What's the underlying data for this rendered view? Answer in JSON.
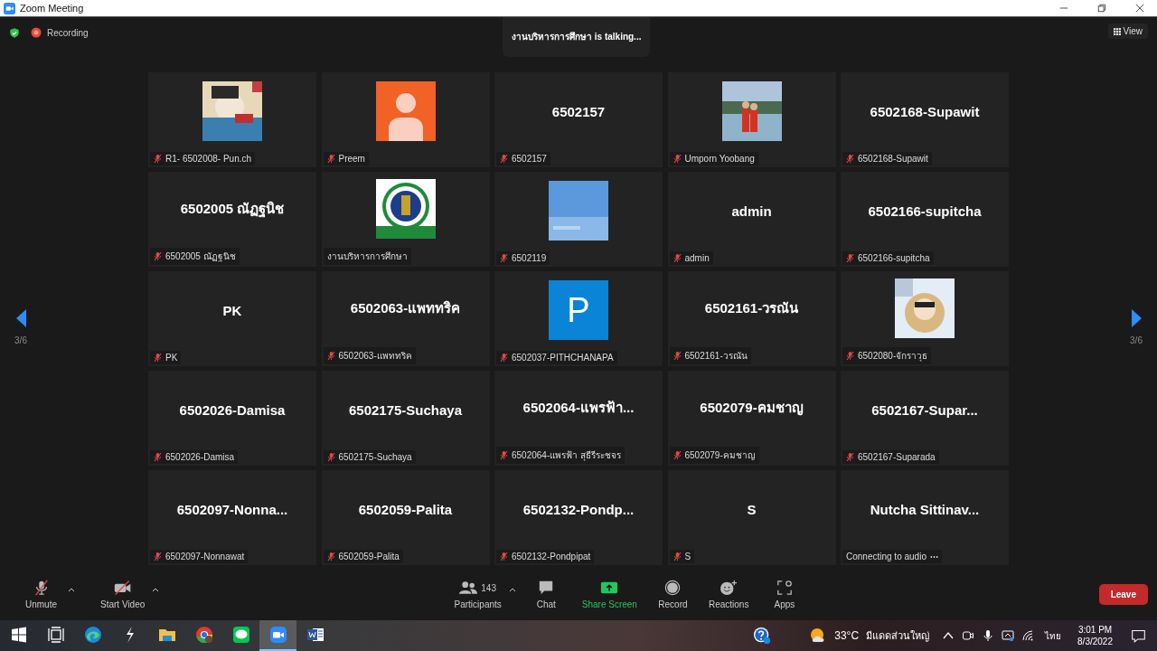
{
  "window": {
    "title": "Zoom Meeting"
  },
  "top_bar": {
    "recording": "Recording",
    "talking": "งานบริหารการศึกษา is  talking...",
    "view": "View"
  },
  "pager": {
    "left": "3/6",
    "right": "3/6"
  },
  "tiles": [
    {
      "kind": "picture",
      "label": "R1- 6502008- Pun.ch",
      "muted": true
    },
    {
      "kind": "silhouette",
      "label": "Preem",
      "muted": true
    },
    {
      "kind": "name",
      "name": "6502157",
      "label": "6502157",
      "muted": true
    },
    {
      "kind": "picture",
      "label": "Umporn Yoobang",
      "muted": true
    },
    {
      "kind": "name",
      "name": "6502168-Supawit",
      "label": "6502168-Supawit",
      "muted": true
    },
    {
      "kind": "name",
      "name": "6502005 ณัฏฐนิช",
      "label": "6502005 ณัฏฐนิช",
      "muted": true
    },
    {
      "kind": "picture",
      "label": "งานบริหารการศึกษา",
      "muted": false,
      "connecting": false
    },
    {
      "kind": "picture",
      "label": "6502119",
      "muted": true
    },
    {
      "kind": "name",
      "name": "admin",
      "label": "admin",
      "muted": true
    },
    {
      "kind": "name",
      "name": "6502166-supitcha",
      "label": "6502166-supitcha",
      "muted": true
    },
    {
      "kind": "name",
      "name": "PK",
      "label": "PK",
      "muted": true
    },
    {
      "kind": "name",
      "name": "6502063-แพททริค",
      "label": "6502063-แพททริค",
      "muted": true
    },
    {
      "kind": "letter",
      "name": "P",
      "label": "6502037-PITHCHANAPA",
      "muted": true
    },
    {
      "kind": "name",
      "name": "6502161-วรณัน",
      "label": "6502161-วรณัน",
      "muted": true
    },
    {
      "kind": "picture",
      "label": "6502080-จักราวุธ",
      "muted": true
    },
    {
      "kind": "name",
      "name": "6502026-Damisa",
      "label": "6502026-Damisa",
      "muted": true
    },
    {
      "kind": "name",
      "name": "6502175-Suchaya",
      "label": "6502175-Suchaya",
      "muted": true
    },
    {
      "kind": "name",
      "name": "6502064-แพรฟ้า...",
      "label": "6502064-แพรฟ้า สุธีรีระชจร",
      "muted": true
    },
    {
      "kind": "name",
      "name": "6502079-คมชาญ",
      "label": "6502079-คมชาญ",
      "muted": true
    },
    {
      "kind": "name",
      "name": "6502167-Supar...",
      "label": "6502167-Suparada",
      "muted": true
    },
    {
      "kind": "name",
      "name": "6502097-Nonna...",
      "label": "6502097-Nonnawat",
      "muted": true
    },
    {
      "kind": "name",
      "name": "6502059-Palita",
      "label": "6502059-Palita",
      "muted": true
    },
    {
      "kind": "name",
      "name": "6502132-Pondp...",
      "label": "6502132-Pondpipat",
      "muted": true
    },
    {
      "kind": "name",
      "name": "S",
      "label": "S",
      "muted": true
    },
    {
      "kind": "name",
      "name": "Nutcha  Sittinav...",
      "label": "Connecting to audio",
      "muted": false,
      "connecting": true
    }
  ],
  "toolbar": {
    "left": [
      {
        "kind": "mic",
        "label": "Unmute"
      },
      {
        "kind": "video",
        "label": "Start Video"
      }
    ],
    "center": [
      {
        "kind": "participants",
        "label": "Participants",
        "count": "143"
      },
      {
        "kind": "chat",
        "label": "Chat"
      },
      {
        "kind": "share",
        "label": "Share Screen"
      },
      {
        "kind": "record",
        "label": "Record"
      },
      {
        "kind": "reactions",
        "label": "Reactions"
      },
      {
        "kind": "apps",
        "label": "Apps"
      }
    ],
    "leave": "Leave"
  },
  "taskbar": {
    "apps": [
      {
        "kind": "start",
        "selected": false
      },
      {
        "kind": "taskview",
        "selected": false
      },
      {
        "kind": "edge",
        "selected": false
      },
      {
        "kind": "bolt",
        "selected": false
      },
      {
        "kind": "folder",
        "selected": false
      },
      {
        "kind": "chrome",
        "selected": false
      },
      {
        "kind": "line",
        "selected": false
      },
      {
        "kind": "zoom",
        "selected": true
      },
      {
        "kind": "word",
        "selected": false
      }
    ],
    "temperature": "33°C",
    "weather": "มีแดดส่วนใหญ่",
    "language": "ไทย",
    "time": "3:01 PM",
    "date": "8/3/2022"
  }
}
